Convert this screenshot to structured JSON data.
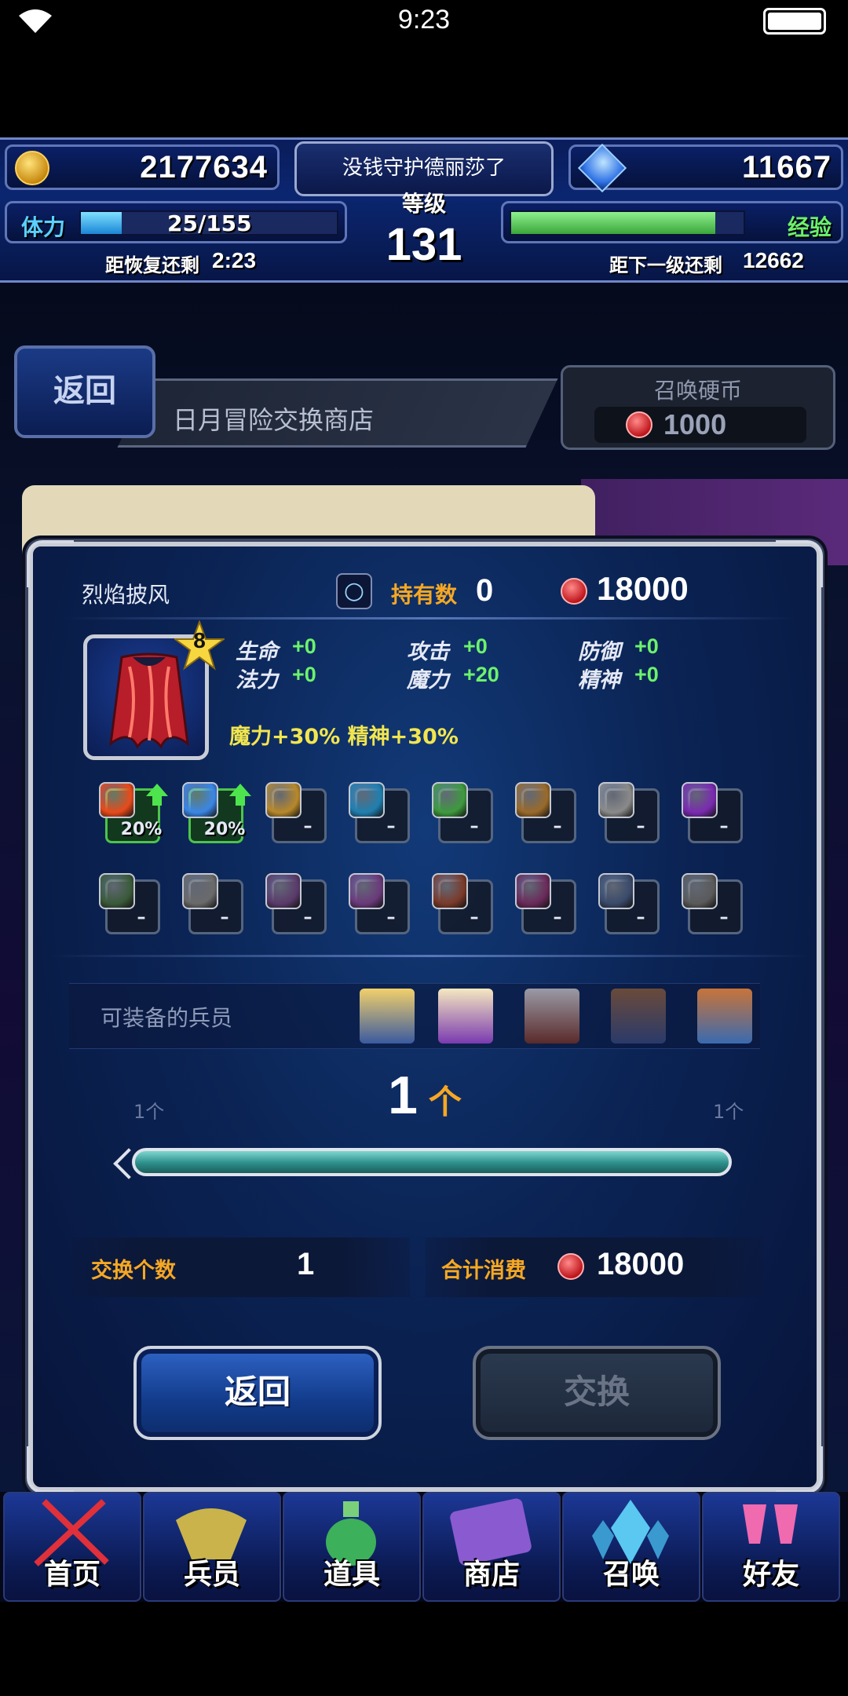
{
  "status_bar": {
    "time": "9:23"
  },
  "hud": {
    "gil": "2177634",
    "gems": "11667",
    "player_name": "没钱守护德丽莎了",
    "level_label": "等级",
    "level": "131",
    "stamina_label": "体力",
    "stamina_value": "25/155",
    "stamina_fraction": 0.16,
    "stamina_recover_label": "距恢复还剩",
    "stamina_recover_time": "2:23",
    "exp_label": "经验",
    "exp_fraction": 0.88,
    "next_level_label": "距下一级还剩",
    "next_level_value": "12662"
  },
  "shop": {
    "back_label": "返回",
    "title": "日月冒险交换商店",
    "currency_panel_title": "召唤硬币",
    "currency_amount": "1000"
  },
  "dialog": {
    "item_name": "烈焰披风",
    "owned_label": "持有数",
    "owned_value": "0",
    "price": "18000",
    "rarity": "8",
    "stats": [
      {
        "label": "生命",
        "value": "+0"
      },
      {
        "label": "攻击",
        "value": "+0"
      },
      {
        "label": "防御",
        "value": "+0"
      },
      {
        "label": "法力",
        "value": "+0"
      },
      {
        "label": "魔力",
        "value": "+20"
      },
      {
        "label": "精神",
        "value": "+0"
      }
    ],
    "bonus_text": "魔力+30% 精神+30%",
    "resistances_row1": [
      {
        "icon": "fire-icon",
        "value": "20%",
        "boosted": true,
        "color": "#e84a1a"
      },
      {
        "icon": "ice-icon",
        "value": "20%",
        "boosted": true,
        "color": "#3a86e6"
      },
      {
        "icon": "lightning-icon",
        "value": "–",
        "boosted": false,
        "color": "#b8882a"
      },
      {
        "icon": "water-icon",
        "value": "–",
        "boosted": false,
        "color": "#1f7fb0"
      },
      {
        "icon": "wind-icon",
        "value": "–",
        "boosted": false,
        "color": "#3e9a3e"
      },
      {
        "icon": "earth-icon",
        "value": "–",
        "boosted": false,
        "color": "#9a6a2a"
      },
      {
        "icon": "holy-icon",
        "value": "–",
        "boosted": false,
        "color": "#8a8a8a"
      },
      {
        "icon": "dark-icon",
        "value": "–",
        "boosted": false,
        "color": "#7a2ab0"
      }
    ],
    "resistances_row2": [
      {
        "icon": "poison-icon",
        "value": "–",
        "color": "#3a5a3a"
      },
      {
        "icon": "blind-icon",
        "value": "–",
        "color": "#6a6a6a"
      },
      {
        "icon": "sleep-icon",
        "value": "–",
        "color": "#5a3a6a"
      },
      {
        "icon": "silence-icon",
        "value": "–",
        "color": "#6a3a7a"
      },
      {
        "icon": "paralysis-icon",
        "value": "–",
        "color": "#7a3a2a"
      },
      {
        "icon": "confusion-icon",
        "value": "–",
        "color": "#6a2a5a"
      },
      {
        "icon": "disease-icon",
        "value": "–",
        "color": "#3a4a6a"
      },
      {
        "icon": "petrify-icon",
        "value": "–",
        "color": "#5a5a5a"
      }
    ],
    "equippable_label": "可装备的兵员",
    "quantity": "1",
    "quantity_unit": "个",
    "min_label": "1个",
    "max_label": "1个",
    "exchange_count_label": "交换个数",
    "exchange_count_value": "1",
    "total_cost_label": "合计消费",
    "total_cost_value": "18000",
    "back_button": "返回",
    "exchange_button": "交换"
  },
  "nav": [
    {
      "label": "首页"
    },
    {
      "label": "兵员"
    },
    {
      "label": "道具"
    },
    {
      "label": "商店"
    },
    {
      "label": "召唤"
    },
    {
      "label": "好友"
    }
  ]
}
